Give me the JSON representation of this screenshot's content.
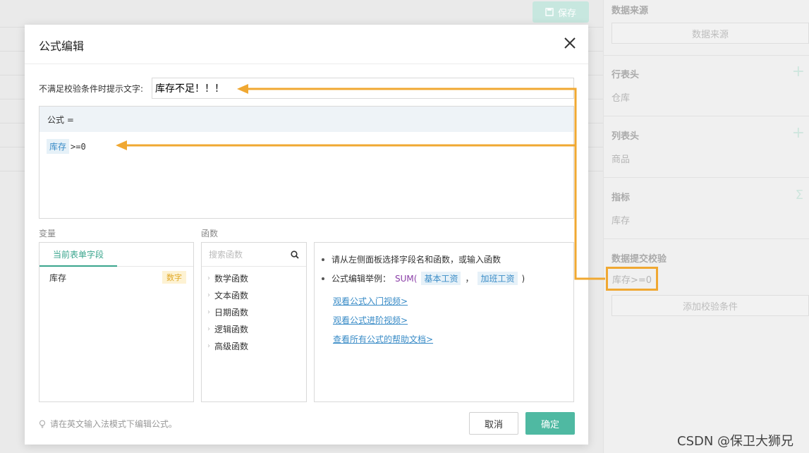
{
  "background": {
    "save_label": "保存",
    "side": {
      "data_source_title": "数据来源",
      "data_source_button": "数据来源",
      "row_header_title": "行表头",
      "row_header_value": "仓库",
      "column_header_title": "列表头",
      "column_header_value": "商品",
      "metric_title": "指标",
      "metric_value": "库存",
      "validation_title": "数据提交校验",
      "validation_value": "库存>=0",
      "add_validation_button": "添加校验条件"
    }
  },
  "modal": {
    "title": "公式编辑",
    "hint_label": "不满足校验条件时提示文字:",
    "hint_value": "库存不足！！！",
    "formula_prefix": "公式 =",
    "formula_field": "库存",
    "formula_rest": ">=0",
    "variables_label": "变量",
    "functions_label": "函数",
    "variables_tab": "当前表单字段",
    "variable": {
      "name": "库存",
      "type": "数字"
    },
    "search_placeholder": "搜索函数",
    "function_categories": [
      "数学函数",
      "文本函数",
      "日期函数",
      "逻辑函数",
      "高级函数"
    ],
    "help": {
      "line1": "请从左侧面板选择字段名和函数，或输入函数",
      "line2_prefix": "公式编辑举例：",
      "line2_fn": "SUM(",
      "line2_arg1": "基本工资",
      "line2_sep": "，",
      "line2_arg2": "加班工资",
      "line2_close": ")",
      "links": [
        "观看公式入门视频>",
        "观看公式进阶视频>",
        "查看所有公式的帮助文档>"
      ]
    },
    "footer_tip": "请在英文输入法模式下编辑公式。",
    "cancel_label": "取消",
    "ok_label": "确定"
  },
  "watermark": "CSDN @保卫大狮兄",
  "colors": {
    "accent": "#4fb9a2",
    "annotation": "#f0a832",
    "link": "#3a8cc7"
  }
}
